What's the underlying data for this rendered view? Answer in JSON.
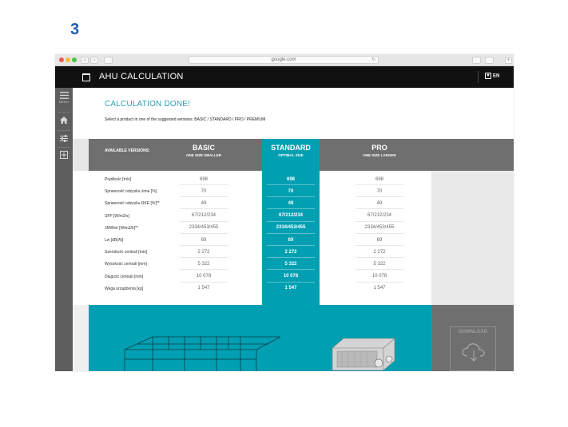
{
  "step_number": "3",
  "browser": {
    "url": "google.com",
    "back_icon": "chevron-left-icon",
    "forward_icon": "chevron-right-icon",
    "reload_icon": "reload-icon"
  },
  "app": {
    "title": "AHU CALCULATION",
    "language": "EN"
  },
  "sidebar": {
    "menu_label": "MENU",
    "items": [
      {
        "icon": "home-icon"
      },
      {
        "icon": "sliders-icon"
      },
      {
        "icon": "add-box-icon"
      }
    ]
  },
  "main": {
    "heading": "CALCULATION DONE!",
    "instruction": "Select a product in one of the suggested versions: BASIC / STANDARD / PRO / PREMIUM",
    "available_label": "AVAILABLE VERSIONS:",
    "versions": [
      {
        "name": "BASIC",
        "subtitle": "ONE SIZE SMALLER"
      },
      {
        "name": "STANDARD",
        "subtitle": "OPTIMAL SIZE"
      },
      {
        "name": "PRO",
        "subtitle": "ONE SIZE LARGER"
      }
    ],
    "rows": [
      {
        "label": "Prędkość [m/s]",
        "basic": "698",
        "standard": "698",
        "pro": "698"
      },
      {
        "label": "Sprawność odzysku zima [%]",
        "basic": "70",
        "standard": "70",
        "pro": "70"
      },
      {
        "label": "Sprawność odzysku RKE [%]**",
        "basic": "49",
        "standard": "49",
        "pro": "49"
      },
      {
        "label": "SFP [W/m3/s]",
        "basic": "67/212/234",
        "standard": "67/212/234",
        "pro": "67/212/234"
      },
      {
        "label": "JMWint [W/m3/h]**",
        "basic": "2334/453/455",
        "standard": "2334/453/455",
        "pro": "2334/453/455"
      },
      {
        "label": "Lw [dB(A)]",
        "basic": "69",
        "standard": "69",
        "pro": "69"
      },
      {
        "label": "Szerokość centrali [mm]",
        "basic": "2 272",
        "standard": "2 272",
        "pro": "2 272"
      },
      {
        "label": "Wysokość centrali [mm]",
        "basic": "5 322",
        "standard": "5 322",
        "pro": "5 322"
      },
      {
        "label": "Długość centrali [mm]",
        "basic": "10 078",
        "standard": "10 078",
        "pro": "10 078"
      },
      {
        "label": "Waga urządzenia [kg]",
        "basic": "1 547",
        "standard": "1 547",
        "pro": "1 547"
      }
    ],
    "download_label": "DOWNLOAD",
    "download_icon": "cloud-download-icon"
  }
}
